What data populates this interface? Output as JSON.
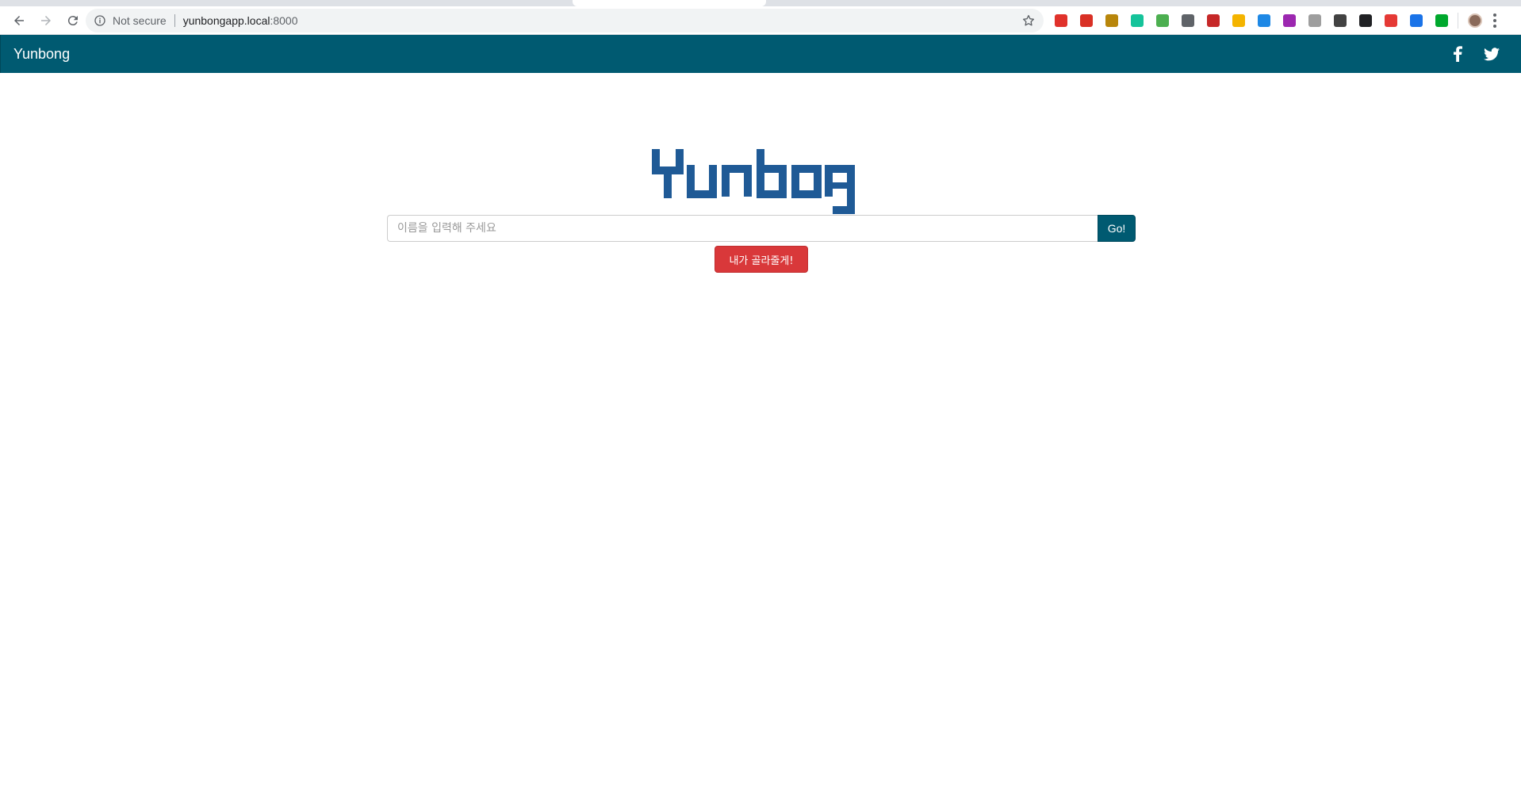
{
  "browser": {
    "security_label": "Not secure",
    "url_host": "yunbongapp.local",
    "url_port": ":8000",
    "extensions": [
      {
        "name": "opera-ext-icon",
        "color": "#e0322b"
      },
      {
        "name": "red-book-ext-icon",
        "color": "#d93025"
      },
      {
        "name": "shield-ext-icon",
        "color": "#b8860b"
      },
      {
        "name": "grammarly-ext-icon",
        "color": "#15c39a"
      },
      {
        "name": "mail-ext-icon",
        "color": "#4caf50"
      },
      {
        "name": "clip-ext-icon",
        "color": "#5f6368"
      },
      {
        "name": "chart-ext-icon",
        "color": "#c62828"
      },
      {
        "name": "bulb-ext-icon",
        "color": "#f4b400"
      },
      {
        "name": "eye-ext-icon",
        "color": "#1e88e5"
      },
      {
        "name": "color-wheel-ext-icon",
        "color": "#9c27b0"
      },
      {
        "name": "grey-ext-icon",
        "color": "#9e9e9e"
      },
      {
        "name": "dark-ext-icon",
        "color": "#424242"
      },
      {
        "name": "glasses-ext-icon",
        "color": "#202124"
      },
      {
        "name": "rainbow-ext-icon",
        "color": "#e53935"
      },
      {
        "name": "hash-ext-icon",
        "color": "#1a73e8"
      },
      {
        "name": "evernote-ext-icon",
        "color": "#00a82d"
      }
    ]
  },
  "navbar": {
    "brand": "Yunbong",
    "bg_color": "#005a71"
  },
  "main": {
    "logo_text": "Yunbong",
    "logo_color": "#1f5a96",
    "search_placeholder": "이름을 입력해 주세요",
    "go_label": "Go!",
    "random_label": "내가 골라줄게!"
  }
}
